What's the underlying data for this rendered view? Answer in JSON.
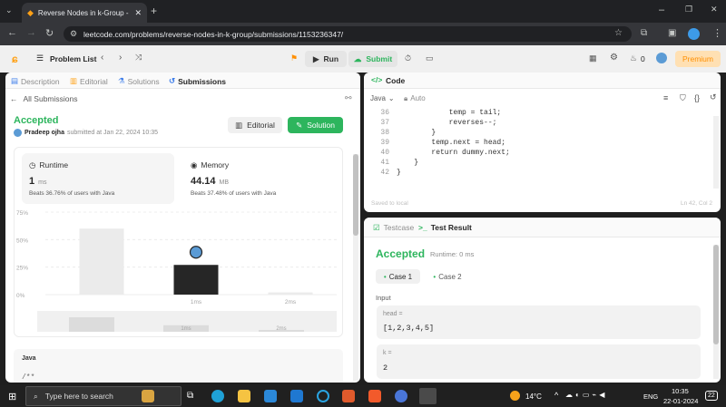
{
  "browser": {
    "tab_title": "Reverse Nodes in k-Group - Lee",
    "url": "leetcode.com/problems/reverse-nodes-in-k-group/submissions/1153236347/"
  },
  "nav": {
    "problem_list": "Problem List",
    "run": "Run",
    "submit": "Submit",
    "coins": "0",
    "premium": "Premium"
  },
  "left_tabs": [
    "Description",
    "Editorial",
    "Solutions",
    "Submissions"
  ],
  "submission": {
    "back_label": "All Submissions",
    "status": "Accepted",
    "user": "Pradeep ojha",
    "submitted_text": "submitted at Jan 22, 2024 10:35",
    "editorial_btn": "Editorial",
    "solution_btn": "Solution",
    "runtime_label": "Runtime",
    "runtime_value": "1",
    "runtime_unit": "ms",
    "runtime_beats": "Beats 36.76% of users with Java",
    "memory_label": "Memory",
    "memory_value": "44.14",
    "memory_unit": "MB",
    "memory_beats": "Beats 37.48% of users with Java",
    "code_lang": "Java",
    "code_first_line": "/**"
  },
  "chart_data": {
    "type": "bar",
    "categories": [
      "",
      "1ms",
      "2ms"
    ],
    "values": [
      60,
      27,
      2
    ],
    "highlight_index": 1,
    "y_ticks": [
      "75%",
      "50%",
      "25%",
      "0%"
    ],
    "ylim": [
      0,
      75
    ],
    "overview_labels": [
      "1ms",
      "2ms"
    ]
  },
  "code_panel": {
    "title": "Code",
    "language": "Java",
    "mode": "Auto",
    "lines": [
      {
        "n": "36",
        "text": "            temp = tail;"
      },
      {
        "n": "37",
        "text": "            reverses--;"
      },
      {
        "n": "38",
        "text": "        }"
      },
      {
        "n": "39",
        "text": "        temp.next = head;"
      },
      {
        "n": "40",
        "text": "        return dummy.next;"
      },
      {
        "n": "41",
        "text": "    }"
      },
      {
        "n": "42",
        "text": "}"
      }
    ],
    "saved": "Saved to local",
    "cursor": "Ln 42, Col 2"
  },
  "result_panel": {
    "testcase_tab": "Testcase",
    "result_tab": "Test Result",
    "status": "Accepted",
    "runtime": "Runtime: 0 ms",
    "cases": [
      "Case 1",
      "Case 2"
    ],
    "input_label": "Input",
    "head_label": "head =",
    "head_value": "[1,2,3,4,5]",
    "k_label": "k =",
    "k_value": "2"
  },
  "taskbar": {
    "search": "Type here to search",
    "weather": "14°C",
    "lang": "ENG",
    "time": "10:35",
    "date": "22-01-2024",
    "notif": "22"
  }
}
